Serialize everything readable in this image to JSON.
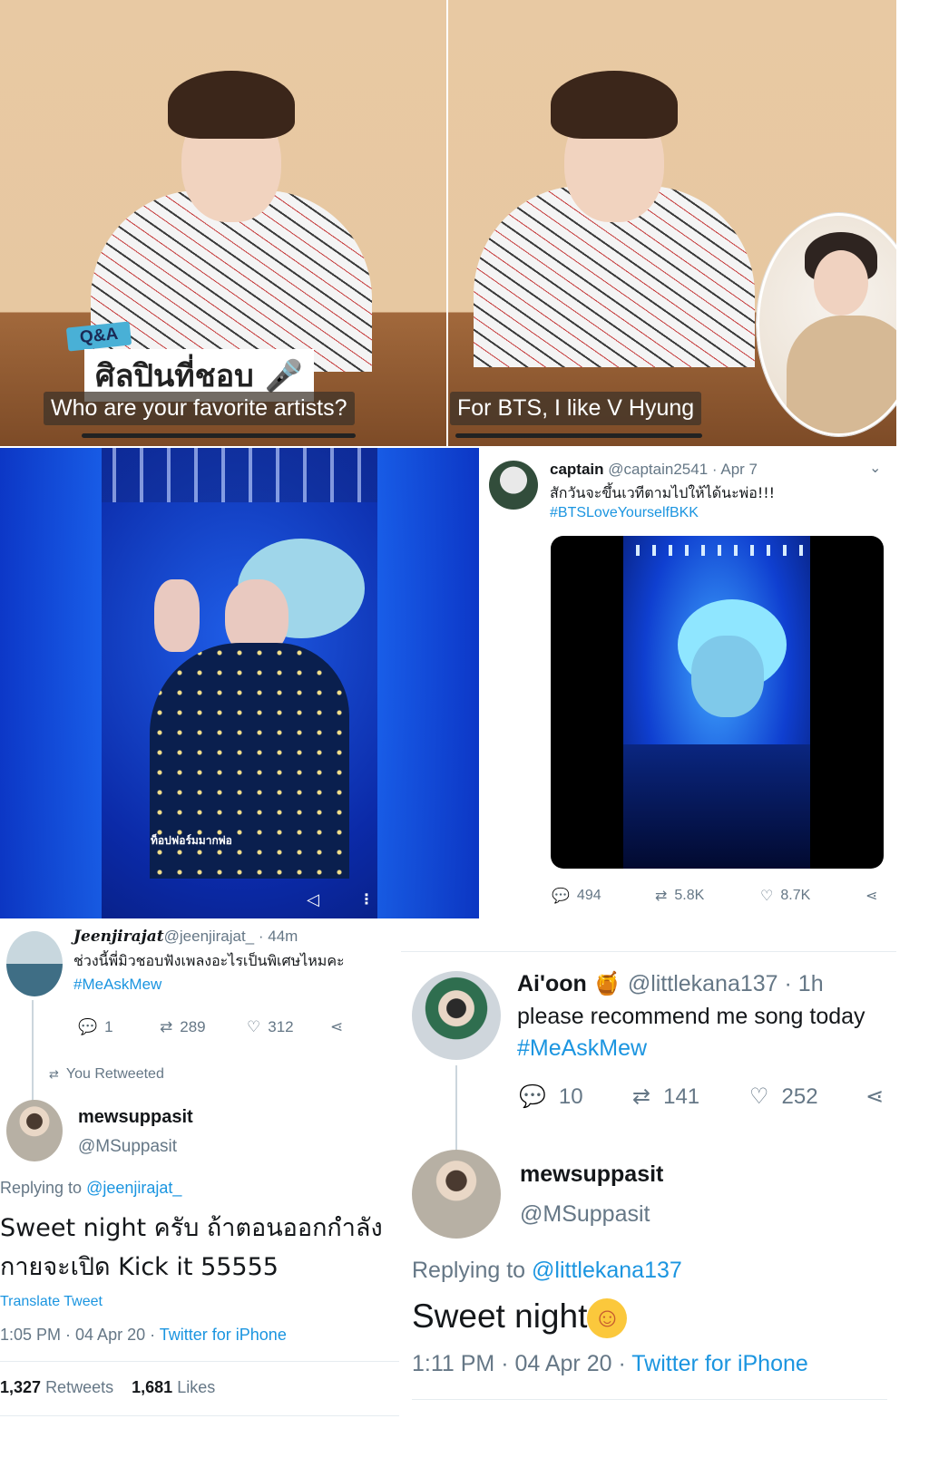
{
  "video_left": {
    "qa_tag": "Q&A",
    "qa_title": "ศิลปินที่ชอบ",
    "subtitle": "Who are your favorite artists?"
  },
  "video_right": {
    "subtitle": "For BTS, I like V Hyung"
  },
  "concert_left": {
    "caption": "ท็อปฟอร์มมากพ่อ"
  },
  "tweet_captain": {
    "name": "captain",
    "handle": "@captain2541",
    "date": "· Apr 7",
    "text": "สักวันจะขึ้นเวทีตามไปให้ได้นะพ่อ!!!",
    "hashtag": "#BTSLoveYourselfBKK",
    "replies": "494",
    "retweets": "5.8K",
    "likes": "8.7K"
  },
  "tweet_jeenji": {
    "name": "Jeenjirajat",
    "handle": "@jeenjirajat_",
    "time": "· 44m",
    "text": "ช่วงนี้พี่มิวชอบฟังเพลงอะไรเป็นพิเศษไหมคะ",
    "hashtag": "#MeAskMew",
    "replies": "1",
    "retweets": "289",
    "likes": "312",
    "retweeted_label": "You Retweeted"
  },
  "reply_left": {
    "name": "mewsuppasit",
    "handle": "@MSuppasit",
    "replying_prefix": "Replying to ",
    "replying_to": "@jeenjirajat_",
    "text_line1": "Sweet night ครับ ถ้าตอนออกกำลัง",
    "text_line2": "กายจะเปิด Kick it 55555",
    "translate": "Translate Tweet",
    "timestamp": "1:05 PM · 04 Apr 20 · ",
    "source": "Twitter for iPhone",
    "retweets_count": "1,327",
    "retweets_label": "Retweets",
    "likes_count": "1,681",
    "likes_label": "Likes"
  },
  "tweet_aioon": {
    "name": "Ai'oon",
    "handle": "@littlekana137",
    "time": "· 1h",
    "text": "please recommend me song today",
    "hashtag": "#MeAskMew",
    "replies": "10",
    "retweets": "141",
    "likes": "252"
  },
  "reply_right": {
    "name": "mewsuppasit",
    "handle": "@MSuppasit",
    "replying_prefix": "Replying to ",
    "replying_to": "@littlekana137",
    "text": "Sweet night",
    "emoji": "☺",
    "timestamp": "1:11 PM · 04 Apr 20 · ",
    "source": "Twitter for iPhone"
  },
  "colors": {
    "link": "#1b95e0",
    "muted": "#657786",
    "concert_blue": "#1f5ee8"
  }
}
